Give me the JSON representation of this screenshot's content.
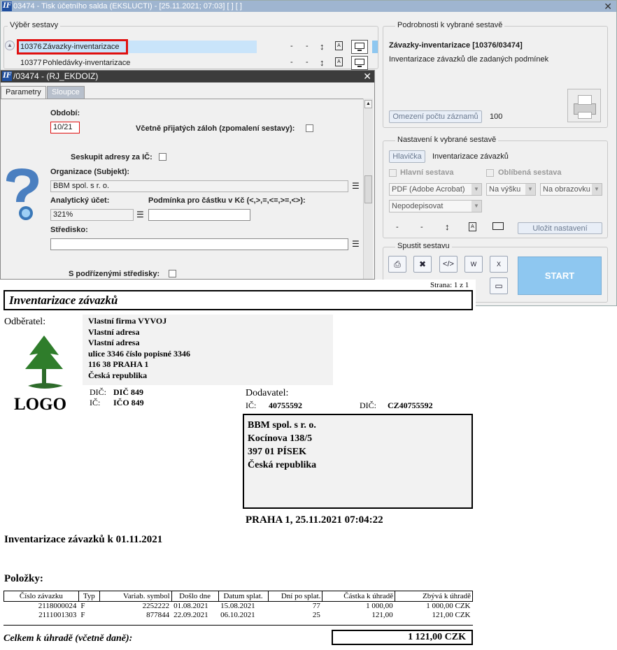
{
  "main_window": {
    "title": "03474 - Tisk účetního salda (EKSLUCTI) - [25.11.2021; 07:03] [ ] [ ]",
    "close_glyph": "✕",
    "app_logo_text": "IF",
    "selection": {
      "legend": "Výběr sestavy",
      "rows": [
        {
          "code": "10376",
          "name": "Závazky-inventarizace",
          "dash1": "-",
          "dash2": "-"
        },
        {
          "code": "10377",
          "name": "Pohledávky-inventarizace",
          "dash1": "-",
          "dash2": "-"
        }
      ]
    },
    "details": {
      "legend": "Podrobnosti k vybrané sestavě",
      "title": "Závazky-inventarizace [10376/03474]",
      "description": "Inventarizace závazků dle zadaných podmínek",
      "limit_button": "Omezení počtu záznamů",
      "limit_value": "100"
    },
    "settings": {
      "legend": "Nastavení k vybrané sestavě",
      "header_button": "Hlavička",
      "header_value": "Inventarizace závazků",
      "main_report_label": "Hlavní sestava",
      "favorite_label": "Oblíbená sestava",
      "format_select": "PDF (Adobe Acrobat)",
      "orientation_select": "Na výšku",
      "output_select": "Na obrazovku",
      "sign_select": "Nepodepisovat",
      "dash1": "-",
      "dash2": "-",
      "save_button": "Uložit nastavení"
    },
    "run": {
      "legend": "Spustit sestavu",
      "start_button": "START"
    }
  },
  "dialog": {
    "title": "/03474 - (RJ_EKDOIZ)",
    "close_glyph": "✕",
    "tabs": [
      {
        "label": "Parametry"
      },
      {
        "label": "Sloupce"
      }
    ],
    "period_label": "Období:",
    "period_value": "10/21",
    "prepayments_label": "Včetně přijatých záloh (zpomalení sestavy):",
    "group_by_ic_label": "Seskupit adresy za IČ:",
    "organization_label": "Organizace (Subjekt):",
    "organization_value": "BBM spol. s r. o.",
    "analytic_label": "Analytický účet:",
    "analytic_value": "321%",
    "amount_condition_label": "Podmínka pro částku v Kč (<,>,=,<=,>=,<>):",
    "amount_condition_value": "",
    "center_label": "Středisko:",
    "center_value": "",
    "subcenters_label": "S podřízenými středisky:"
  },
  "report": {
    "page_label": "Strana: 1 z 1",
    "title": "Inventarizace závazků",
    "customer_label": "Odběratel:",
    "customer": {
      "lines": [
        "Vlastní firma VYVOJ",
        "Vlastní adresa",
        "Vlastní adresa",
        "ulice 3346 číslo popisné 3346",
        "116 38 PRAHA 1",
        "Česká republika"
      ],
      "dic_label": "DIČ:",
      "dic_value": "DIČ 849",
      "ic_label": "IČ:",
      "ic_value": "IČO 849"
    },
    "logo_text": "LOGO",
    "supplier_label": "Dodavatel:",
    "supplier": {
      "ic_label": "IČ:",
      "ic_value": "40755592",
      "dic_label": "DIČ:",
      "dic_value": "CZ40755592",
      "lines": [
        "BBM spol. s r. o.",
        "Kocínova 138/5",
        "397 01 PÍSEK",
        "Česká republika"
      ]
    },
    "place_date": "PRAHA 1, 25.11.2021 07:04:22",
    "subtitle": "Inventarizace závazků k 01.11.2021",
    "items_label": "Položky:",
    "columns": [
      "Číslo závazku",
      "Typ",
      "Variab. symbol",
      "Došlo dne",
      "Datum splat.",
      "Dní po splat.",
      "Částka k úhradě",
      "Zbývá k úhradě"
    ],
    "rows": [
      [
        "2118000024",
        "F",
        "2252222",
        "01.08.2021",
        "15.08.2021",
        "77",
        "1 000,00",
        "1 000,00 CZK"
      ],
      [
        "2111001303",
        "F",
        "877844",
        "22.09.2021",
        "06.10.2021",
        "25",
        "121,00",
        "121,00 CZK"
      ]
    ],
    "total_label": "Celkem k úhradě (včetně daně):",
    "total_value": "1 121,00 CZK"
  },
  "colors": {
    "title_bar": "#9fb5d0",
    "selection_highlight": "#c9e4fa",
    "highlight_border": "#e01010",
    "start_button": "#8ec7f0",
    "dialog_title": "#3c3c3c"
  }
}
